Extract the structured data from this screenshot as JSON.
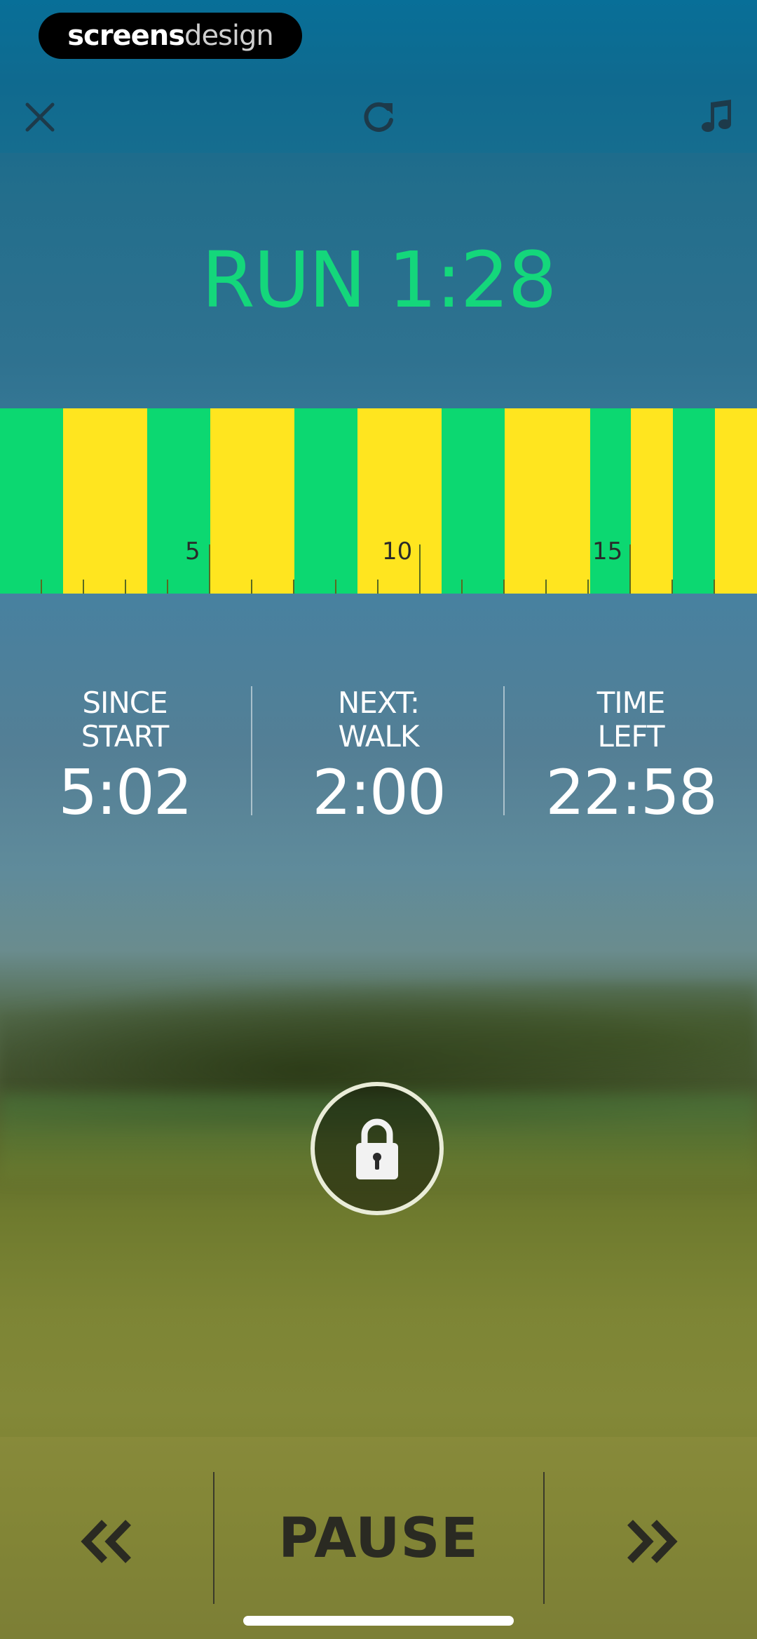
{
  "logo": {
    "part1": "screens",
    "part2": "design"
  },
  "toolbar": {
    "close_icon": "close-icon",
    "restart_icon": "restart-icon",
    "music_icon": "music-note-icon"
  },
  "current": {
    "title": "RUN 1:28"
  },
  "timeline": {
    "colors": {
      "run": "#0cd871",
      "walk": "#ffe51f"
    },
    "tick_labels": [
      "5",
      "10",
      "15"
    ]
  },
  "stats": [
    {
      "label_line1": "SINCE",
      "label_line2": "START",
      "value": "5:02"
    },
    {
      "label_line1": "NEXT:",
      "label_line2": "WALK",
      "value": "2:00"
    },
    {
      "label_line1": "TIME",
      "label_line2": "LEFT",
      "value": "22:58"
    }
  ],
  "lock": {
    "icon": "lock-icon"
  },
  "controls": {
    "pause_label": "PAUSE",
    "prev_icon": "double-chevron-left-icon",
    "next_icon": "double-chevron-right-icon"
  }
}
